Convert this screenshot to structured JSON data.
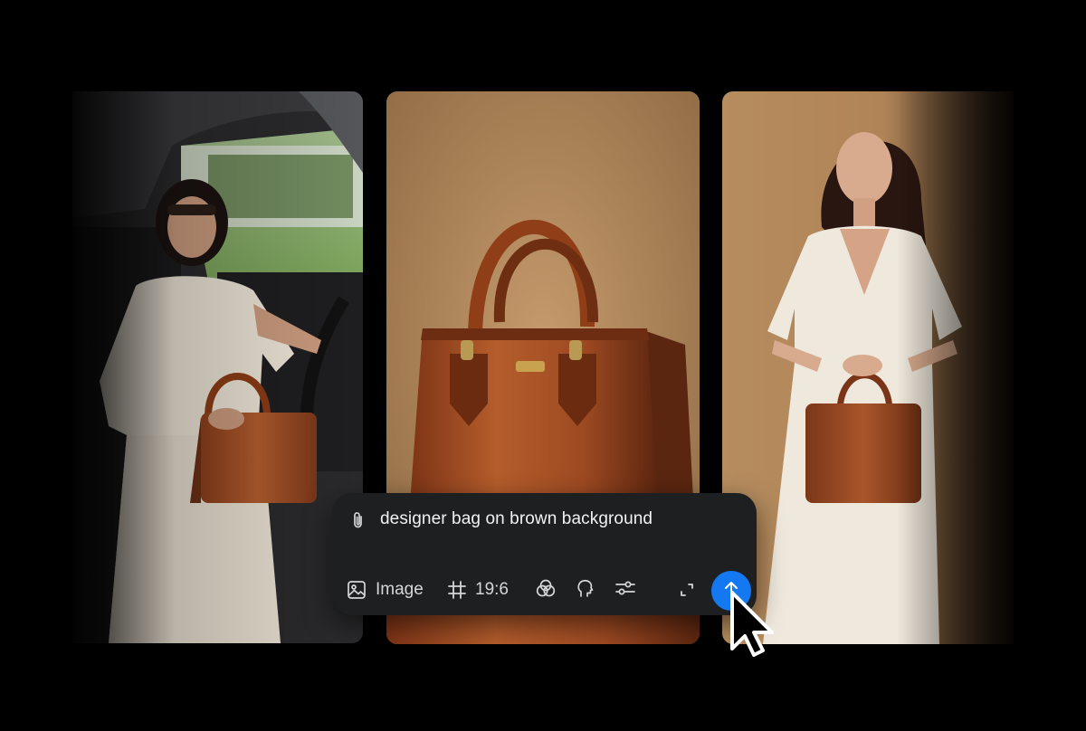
{
  "gallery": {
    "cards": [
      {
        "name": "woman-in-car-with-bag"
      },
      {
        "name": "bag-on-brown-background"
      },
      {
        "name": "woman-holding-bag-studio"
      }
    ]
  },
  "composer": {
    "prompt": "designer bag on brown background",
    "toolbar": {
      "image_label": "Image",
      "aspect_ratio": "19:6"
    },
    "icons": {
      "attach": "paperclip-icon",
      "image": "image-icon",
      "aspect": "hash-grid-icon",
      "style": "spiral-style-icon",
      "character": "head-profile-icon",
      "settings": "sliders-icon",
      "expand": "expand-icon",
      "send": "arrow-up-icon"
    },
    "accent_color": "#1478f0"
  }
}
